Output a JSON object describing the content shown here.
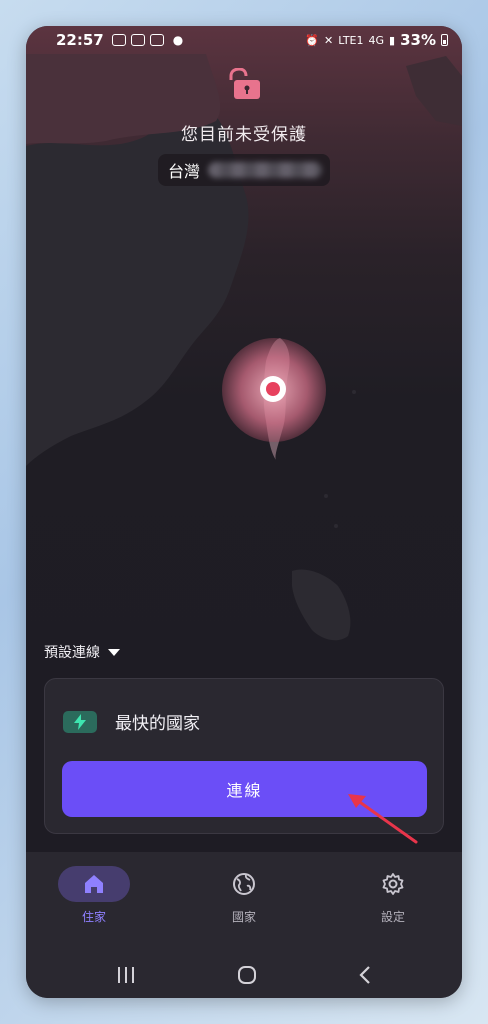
{
  "status_bar": {
    "time": "22:57",
    "network": "LTE1",
    "signal": "4G",
    "battery": "33%"
  },
  "protection": {
    "title": "您目前未受保護",
    "location": "台灣"
  },
  "preset": {
    "label": "預設連線"
  },
  "card": {
    "fastest_label": "最快的國家",
    "connect_label": "連線"
  },
  "nav": {
    "items": [
      {
        "label": "住家",
        "icon": "home-icon",
        "active": true
      },
      {
        "label": "國家",
        "icon": "globe-icon",
        "active": false
      },
      {
        "label": "設定",
        "icon": "gear-icon",
        "active": false
      }
    ]
  },
  "colors": {
    "accent": "#6b4ef7",
    "lock": "#e8738d",
    "pin": "#e7415e",
    "bolt_badge": "#2b6b5c",
    "bolt": "#3ee6b0",
    "annotation_arrow": "#e8354b"
  }
}
